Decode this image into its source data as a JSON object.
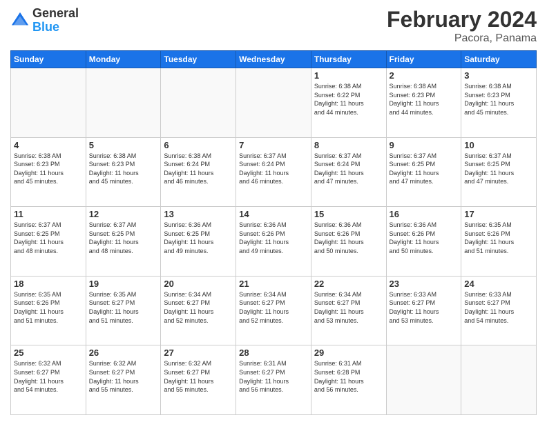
{
  "header": {
    "logo": {
      "line1": "General",
      "line2": "Blue"
    },
    "title": "February 2024",
    "location": "Pacora, Panama"
  },
  "weekdays": [
    "Sunday",
    "Monday",
    "Tuesday",
    "Wednesday",
    "Thursday",
    "Friday",
    "Saturday"
  ],
  "weeks": [
    [
      {
        "day": "",
        "info": ""
      },
      {
        "day": "",
        "info": ""
      },
      {
        "day": "",
        "info": ""
      },
      {
        "day": "",
        "info": ""
      },
      {
        "day": "1",
        "info": "Sunrise: 6:38 AM\nSunset: 6:22 PM\nDaylight: 11 hours\nand 44 minutes."
      },
      {
        "day": "2",
        "info": "Sunrise: 6:38 AM\nSunset: 6:23 PM\nDaylight: 11 hours\nand 44 minutes."
      },
      {
        "day": "3",
        "info": "Sunrise: 6:38 AM\nSunset: 6:23 PM\nDaylight: 11 hours\nand 45 minutes."
      }
    ],
    [
      {
        "day": "4",
        "info": "Sunrise: 6:38 AM\nSunset: 6:23 PM\nDaylight: 11 hours\nand 45 minutes."
      },
      {
        "day": "5",
        "info": "Sunrise: 6:38 AM\nSunset: 6:23 PM\nDaylight: 11 hours\nand 45 minutes."
      },
      {
        "day": "6",
        "info": "Sunrise: 6:38 AM\nSunset: 6:24 PM\nDaylight: 11 hours\nand 46 minutes."
      },
      {
        "day": "7",
        "info": "Sunrise: 6:37 AM\nSunset: 6:24 PM\nDaylight: 11 hours\nand 46 minutes."
      },
      {
        "day": "8",
        "info": "Sunrise: 6:37 AM\nSunset: 6:24 PM\nDaylight: 11 hours\nand 47 minutes."
      },
      {
        "day": "9",
        "info": "Sunrise: 6:37 AM\nSunset: 6:25 PM\nDaylight: 11 hours\nand 47 minutes."
      },
      {
        "day": "10",
        "info": "Sunrise: 6:37 AM\nSunset: 6:25 PM\nDaylight: 11 hours\nand 47 minutes."
      }
    ],
    [
      {
        "day": "11",
        "info": "Sunrise: 6:37 AM\nSunset: 6:25 PM\nDaylight: 11 hours\nand 48 minutes."
      },
      {
        "day": "12",
        "info": "Sunrise: 6:37 AM\nSunset: 6:25 PM\nDaylight: 11 hours\nand 48 minutes."
      },
      {
        "day": "13",
        "info": "Sunrise: 6:36 AM\nSunset: 6:25 PM\nDaylight: 11 hours\nand 49 minutes."
      },
      {
        "day": "14",
        "info": "Sunrise: 6:36 AM\nSunset: 6:26 PM\nDaylight: 11 hours\nand 49 minutes."
      },
      {
        "day": "15",
        "info": "Sunrise: 6:36 AM\nSunset: 6:26 PM\nDaylight: 11 hours\nand 50 minutes."
      },
      {
        "day": "16",
        "info": "Sunrise: 6:36 AM\nSunset: 6:26 PM\nDaylight: 11 hours\nand 50 minutes."
      },
      {
        "day": "17",
        "info": "Sunrise: 6:35 AM\nSunset: 6:26 PM\nDaylight: 11 hours\nand 51 minutes."
      }
    ],
    [
      {
        "day": "18",
        "info": "Sunrise: 6:35 AM\nSunset: 6:26 PM\nDaylight: 11 hours\nand 51 minutes."
      },
      {
        "day": "19",
        "info": "Sunrise: 6:35 AM\nSunset: 6:27 PM\nDaylight: 11 hours\nand 51 minutes."
      },
      {
        "day": "20",
        "info": "Sunrise: 6:34 AM\nSunset: 6:27 PM\nDaylight: 11 hours\nand 52 minutes."
      },
      {
        "day": "21",
        "info": "Sunrise: 6:34 AM\nSunset: 6:27 PM\nDaylight: 11 hours\nand 52 minutes."
      },
      {
        "day": "22",
        "info": "Sunrise: 6:34 AM\nSunset: 6:27 PM\nDaylight: 11 hours\nand 53 minutes."
      },
      {
        "day": "23",
        "info": "Sunrise: 6:33 AM\nSunset: 6:27 PM\nDaylight: 11 hours\nand 53 minutes."
      },
      {
        "day": "24",
        "info": "Sunrise: 6:33 AM\nSunset: 6:27 PM\nDaylight: 11 hours\nand 54 minutes."
      }
    ],
    [
      {
        "day": "25",
        "info": "Sunrise: 6:32 AM\nSunset: 6:27 PM\nDaylight: 11 hours\nand 54 minutes."
      },
      {
        "day": "26",
        "info": "Sunrise: 6:32 AM\nSunset: 6:27 PM\nDaylight: 11 hours\nand 55 minutes."
      },
      {
        "day": "27",
        "info": "Sunrise: 6:32 AM\nSunset: 6:27 PM\nDaylight: 11 hours\nand 55 minutes."
      },
      {
        "day": "28",
        "info": "Sunrise: 6:31 AM\nSunset: 6:27 PM\nDaylight: 11 hours\nand 56 minutes."
      },
      {
        "day": "29",
        "info": "Sunrise: 6:31 AM\nSunset: 6:28 PM\nDaylight: 11 hours\nand 56 minutes."
      },
      {
        "day": "",
        "info": ""
      },
      {
        "day": "",
        "info": ""
      }
    ]
  ]
}
